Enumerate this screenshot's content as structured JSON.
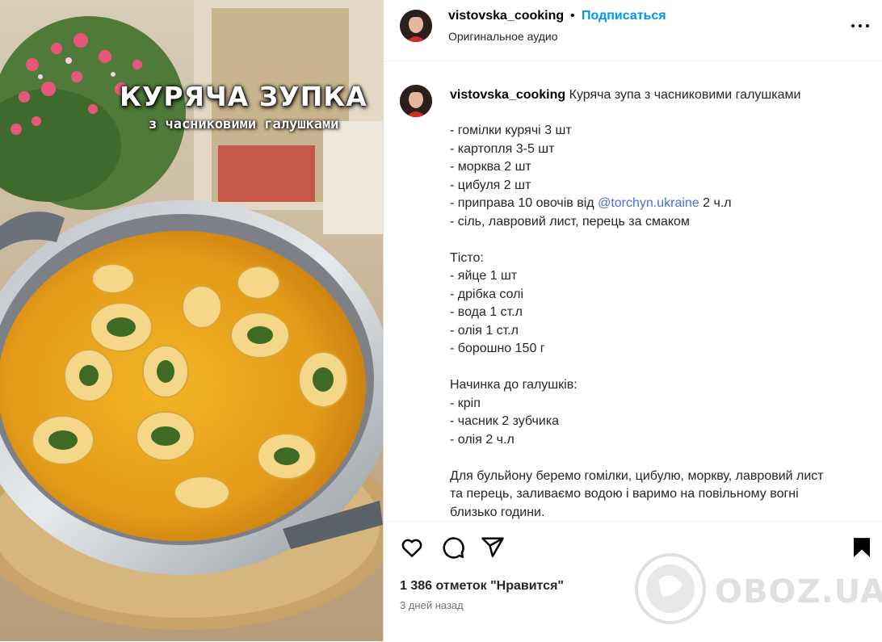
{
  "media": {
    "overlay_title": "КУРЯЧА ЗУПКА",
    "overlay_subtitle": "з часниковими галушками"
  },
  "header": {
    "username": "vistovska_cooking",
    "separator": "•",
    "follow_label": "Подписаться",
    "audio_label": "Оригинальное аудио",
    "more_icon": "more-horizontal-icon"
  },
  "caption": {
    "username": "vistovska_cooking",
    "title": "Куряча зупа з часниковими галушками",
    "lines": [
      "- гомілки курячі 3 шт",
      "- картопля 3-5 шт",
      "- морква 2 шт",
      "- цибуля 2 шт",
      "",
      "- сіль, лавровий лист, перець за смаком",
      "",
      "Тісто:",
      "- яйце 1 шт",
      "- дрібка солі",
      "- вода 1 ст.л",
      "- олія 1 ст.л",
      "- борошно 150 г",
      "",
      "Начинка до галушків:",
      "- кріп",
      "- часник 2 зубчика",
      "- олія 2 ч.л",
      "",
      "Для бульйону беремо гомілки, цибулю, моркву, лавровий лист",
      "та перець, заливаємо водою і варимо на повільному вогні",
      "близько години."
    ],
    "mention_line": {
      "before": "- приправа 10 овочів від ",
      "mention": "@torchyn.ukraine",
      "after": " 2 ч.л"
    }
  },
  "actions": {
    "icons": [
      "heart-icon",
      "comment-icon",
      "share-icon",
      "bookmark-icon"
    ],
    "likes": "1 386 отметок \"Нравится\"",
    "date": "3 дней назад"
  },
  "watermark": {
    "text": "OBOZ.UA"
  },
  "colors": {
    "follow": "#0095f6",
    "mention": "#4a6ee0",
    "soup": "#e9a11e"
  }
}
